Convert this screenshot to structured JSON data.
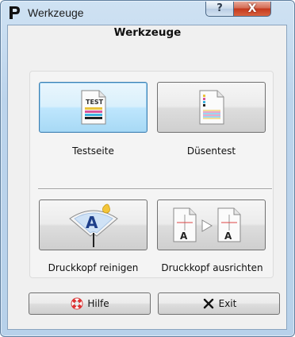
{
  "window": {
    "title": "Werkzeuge",
    "help_glyph": "?",
    "close_glyph": "X",
    "icons": {
      "app": "printer-app-icon",
      "help": "help-icon",
      "close": "close-icon"
    }
  },
  "heading": "Werkzeuge",
  "tools": [
    {
      "label": "Testseite",
      "icon": "test-page-icon",
      "icon_text": "TEST",
      "selected": true
    },
    {
      "label": "Düsentest",
      "icon": "nozzle-check-icon",
      "selected": false
    },
    {
      "label": "Druckkopf reinigen",
      "icon": "head-cleaning-icon",
      "icon_text": "A",
      "selected": false
    },
    {
      "label": "Druckkopf ausrichten",
      "icon": "head-alignment-icon",
      "icon_text": "A",
      "selected": false
    }
  ],
  "buttons": {
    "help": {
      "label": "Hilfe",
      "icon": "lifebuoy-icon"
    },
    "exit": {
      "label": "Exit",
      "icon": "x-icon"
    }
  },
  "colors": {
    "selected_border": "#3c7fb1",
    "close_red": "#c5381d",
    "window_frame": "#b7d1ea"
  }
}
